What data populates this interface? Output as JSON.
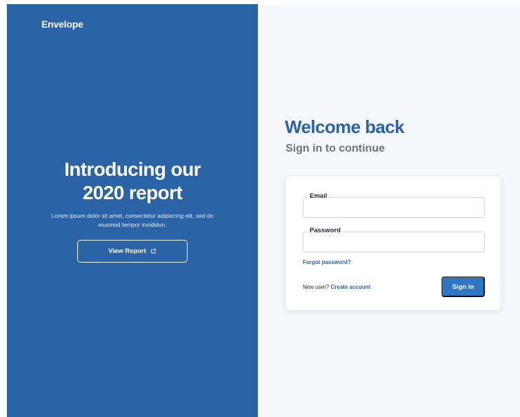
{
  "brand": {
    "name": "Envelope"
  },
  "promo": {
    "title": "Introducing our 2020 report",
    "description": "Lorem ipsum dolor sit amet, consectetur adipiscing elit, sed do eiusmod tempor incididun.",
    "button_label": "View Report",
    "button_icon": "external-link-icon"
  },
  "login": {
    "heading": "Welcome back",
    "subheading": "Sign in to continue",
    "email_label": "Email",
    "email_value": "",
    "password_label": "Password",
    "password_value": "",
    "forgot_label": "Forgot password?",
    "new_user_text": "New user?",
    "create_account_label": "Create account",
    "signin_label": "Sign in"
  },
  "colors": {
    "brand_blue": "#2a63a6",
    "button_blue": "#2f76c6",
    "panel_bg": "#f5f7fa"
  }
}
